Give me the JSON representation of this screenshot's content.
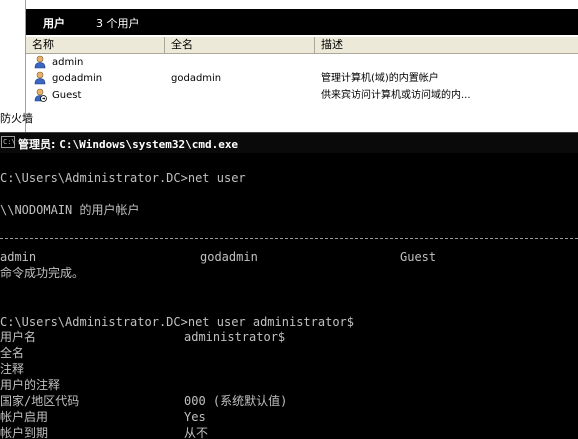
{
  "mmc": {
    "tree_label": "防火墙",
    "header": {
      "title": "用户",
      "count": "3 个用户"
    },
    "columns": [
      "名称",
      "全名",
      "描述"
    ],
    "users": [
      {
        "name": "admin",
        "full_name": "",
        "description": ""
      },
      {
        "name": "godadmin",
        "full_name": "godadmin",
        "description": "管理计算机(域)的内置帐户"
      },
      {
        "name": "Guest",
        "full_name": "",
        "description": "供来宾访问计算机或访问域的内..."
      }
    ]
  },
  "console": {
    "title_prefix": "管理员:",
    "title_path": "C:\\Windows\\system32\\cmd.exe",
    "prompt1": "C:\\Users\\Administrator.DC>net user",
    "accounts_header": "\\\\NODOMAIN 的用户帐户",
    "account1": "admin",
    "account2": "godadmin",
    "account3": "Guest",
    "success": "命令成功完成。",
    "prompt2": "C:\\Users\\Administrator.DC>net user administrator$",
    "details": [
      {
        "label": "用户名",
        "value": "administrator$"
      },
      {
        "label": "全名",
        "value": ""
      },
      {
        "label": "注释",
        "value": ""
      },
      {
        "label": "用户的注释",
        "value": ""
      },
      {
        "label": "国家/地区代码",
        "value": "000 (系统默认值)"
      },
      {
        "label": "帐户启用",
        "value": "Yes"
      },
      {
        "label": "帐户到期",
        "value": "从不"
      }
    ]
  },
  "colors": {
    "console_bg": "#000000",
    "console_text": "#c0c0c0",
    "header_bar": "#000000"
  }
}
